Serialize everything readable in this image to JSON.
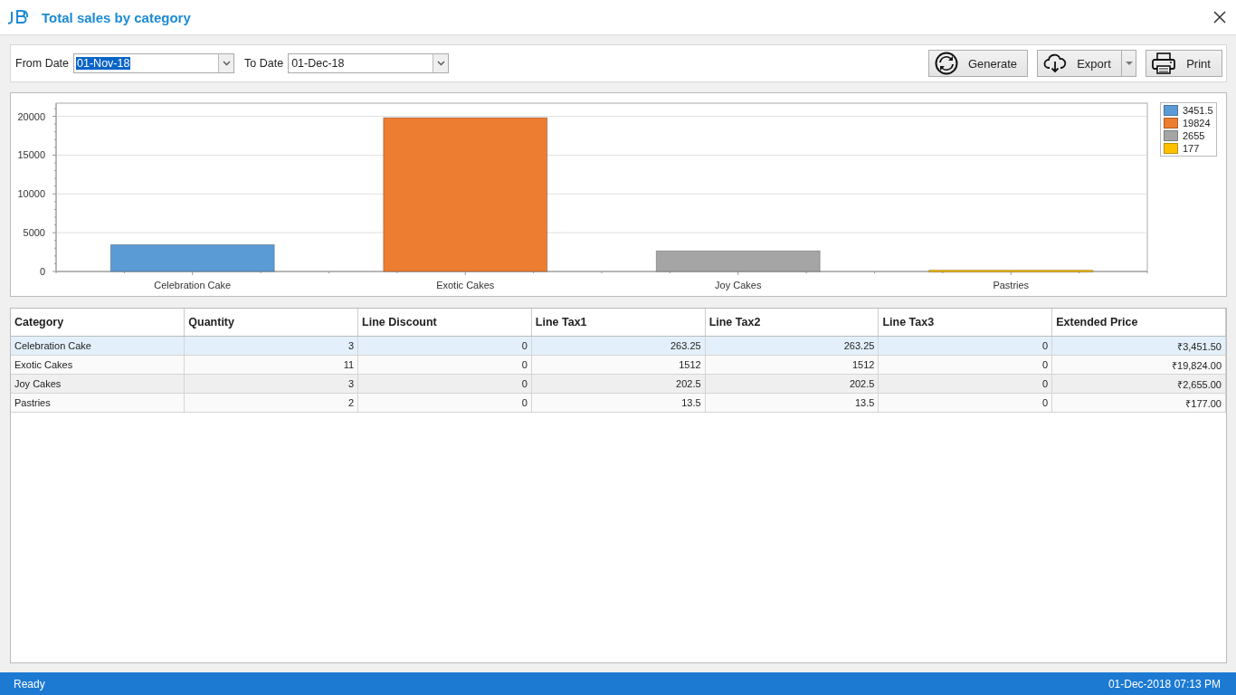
{
  "window": {
    "title": "Total sales by category"
  },
  "filters": [
    {
      "label": "From Date",
      "value": "01-Nov-18",
      "selected": true
    },
    {
      "label": "To Date",
      "value": "01-Dec-18",
      "selected": false
    }
  ],
  "buttons": [
    {
      "kind": "generate",
      "label": "Generate"
    },
    {
      "kind": "export",
      "label": "Export"
    },
    {
      "kind": "print",
      "label": "Print"
    }
  ],
  "chart": {
    "chart_data": {
      "type": "bar",
      "grid": true,
      "legend": "right",
      "categories": [
        "Celebration Cake",
        "Exotic Cakes",
        "Joy Cakes",
        "Pastries"
      ],
      "ylim": [
        0,
        21700
      ],
      "yticks": [
        0,
        5000,
        10000,
        15000,
        20000
      ],
      "series": [
        {
          "name": "3451.5",
          "color": "#5b9bd5",
          "values": [
            3451.5,
            null,
            null,
            null
          ]
        },
        {
          "name": "19824",
          "color": "#ed7d31",
          "values": [
            null,
            19824,
            null,
            null
          ]
        },
        {
          "name": "2655",
          "color": "#a5a5a5",
          "values": [
            null,
            null,
            2655,
            null
          ]
        },
        {
          "name": "177",
          "color": "#ffc000",
          "values": [
            null,
            null,
            null,
            177
          ]
        }
      ]
    }
  },
  "table": {
    "columns": [
      "Category",
      "Quantity",
      "Line Discount",
      "Line Tax1",
      "Line Tax2",
      "Line Tax3",
      "Extended Price"
    ],
    "rows": [
      {
        "selected": true,
        "cells": [
          "Celebration Cake",
          "3",
          "0",
          "263.25",
          "263.25",
          "0",
          "₹3,451.50"
        ]
      },
      {
        "selected": false,
        "cells": [
          "Exotic Cakes",
          "11",
          "0",
          "1512",
          "1512",
          "0",
          "₹19,824.00"
        ]
      },
      {
        "selected": false,
        "cells": [
          "Joy Cakes",
          "3",
          "0",
          "202.5",
          "202.5",
          "0",
          "₹2,655.00"
        ]
      },
      {
        "selected": false,
        "cells": [
          "Pastries",
          "2",
          "0",
          "13.5",
          "13.5",
          "0",
          "₹177.00"
        ]
      }
    ]
  },
  "status_bar": {
    "status": "Ready",
    "datetime": "01-Dec-2018 07:13 PM"
  }
}
